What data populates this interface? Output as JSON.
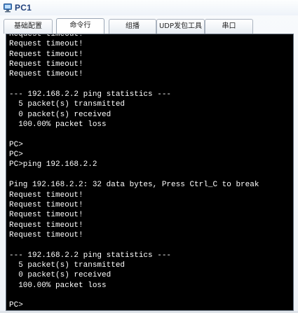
{
  "window": {
    "title": "PC1",
    "icon": "pc-monitor-icon"
  },
  "tabs": [
    {
      "label": "基础配置",
      "active": false
    },
    {
      "label": "命令行",
      "active": true
    },
    {
      "label": "组播",
      "active": false
    },
    {
      "label": "UDP发包工具",
      "active": false
    },
    {
      "label": "串口",
      "active": false
    }
  ],
  "terminal": {
    "background": "#000000",
    "foreground": "#ffffff",
    "lines": [
      "Request timeout!",
      "Request timeout!",
      "Request timeout!",
      "Request timeout!",
      "Request timeout!",
      "",
      "--- 192.168.2.2 ping statistics ---",
      "  5 packet(s) transmitted",
      "  0 packet(s) received",
      "  100.00% packet loss",
      "",
      "PC>",
      "PC>",
      "PC>ping 192.168.2.2",
      "",
      "Ping 192.168.2.2: 32 data bytes, Press Ctrl_C to break",
      "Request timeout!",
      "Request timeout!",
      "Request timeout!",
      "Request timeout!",
      "Request timeout!",
      "",
      "--- 192.168.2.2 ping statistics ---",
      "  5 packet(s) transmitted",
      "  0 packet(s) received",
      "  100.00% packet loss",
      "",
      "PC>"
    ]
  }
}
